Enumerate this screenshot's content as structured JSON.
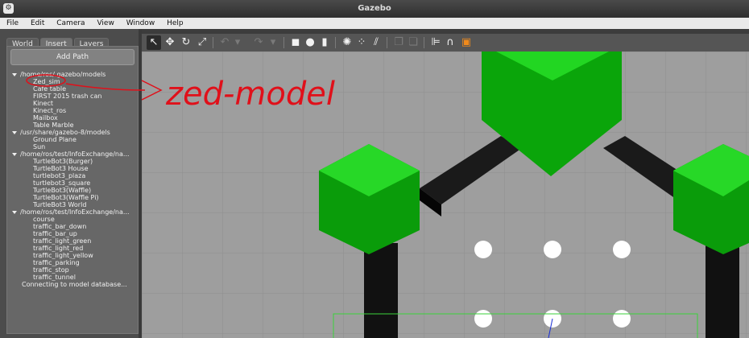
{
  "window": {
    "title": "Gazebo"
  },
  "menu": [
    "File",
    "Edit",
    "Camera",
    "View",
    "Window",
    "Help"
  ],
  "tabs": [
    "World",
    "Insert",
    "Layers"
  ],
  "insert_panel": {
    "add_path_label": "Add Path",
    "folders": [
      {
        "path": "/home/ros/.gazebo/models",
        "items": [
          "Zed_sim",
          "Cafe table",
          "FIRST 2015 trash can",
          "Kinect",
          "Kinect_ros",
          "Mailbox",
          "Table Marble"
        ]
      },
      {
        "path": "/usr/share/gazebo-8/models",
        "items": [
          "Ground Plane",
          "Sun"
        ]
      },
      {
        "path": "/home/ros/test/InfoExchange/na...",
        "items": [
          "TurtleBot3(Burger)",
          "TurtleBot3 House",
          "turtlebot3_plaza",
          "turtlebot3_square",
          "TurtleBot3(Waffle)",
          "TurtleBot3(Waffle Pi)",
          "TurtleBot3 World"
        ]
      },
      {
        "path": "/home/ros/test/InfoExchange/na...",
        "items": [
          "course",
          "traffic_bar_down",
          "traffic_bar_up",
          "traffic_light_green",
          "traffic_light_red",
          "traffic_light_yellow",
          "traffic_parking",
          "traffic_stop",
          "traffic_tunnel"
        ]
      }
    ],
    "status": "Connecting to model database..."
  },
  "toolbar": {
    "icons": [
      "select-icon",
      "translate-icon",
      "rotate-icon",
      "scale-icon",
      "undo-icon",
      "redo-icon",
      "box-icon",
      "sphere-icon",
      "cylinder-icon",
      "point-light-icon",
      "spot-light-icon",
      "directional-light-icon",
      "copy-icon",
      "paste-icon",
      "align-icon",
      "snap-icon",
      "change-view-icon"
    ]
  },
  "annotation": {
    "handwritten_text": "zed-model",
    "color": "#e0101a"
  },
  "colors": {
    "model_green": "#10c010",
    "model_dark_green": "#0a8a0a",
    "arm_black": "#111111",
    "ground": "#9e9e9e"
  }
}
